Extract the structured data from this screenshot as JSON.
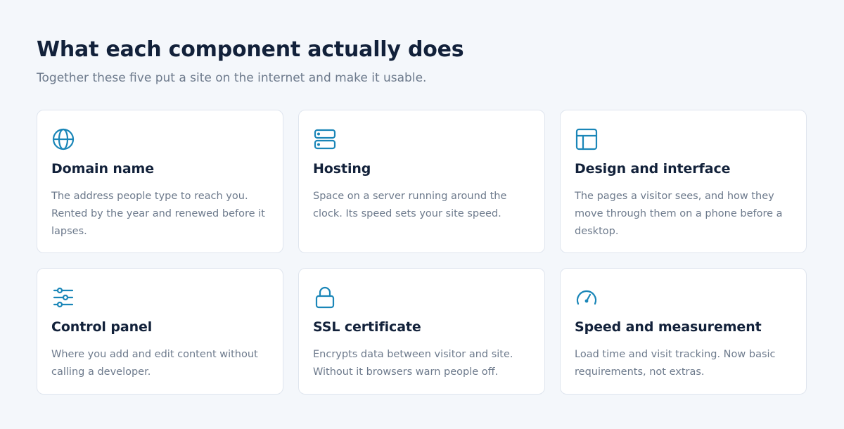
{
  "header": {
    "title": "What each component actually does",
    "subtitle": "Together these five put a site on the internet and make it usable."
  },
  "colors": {
    "accent": "#1a86b8",
    "heading": "#12213a",
    "body_text": "#6d7a8c",
    "background": "#f4f7fb",
    "card": "#ffffff",
    "card_border": "#dfe5ee"
  },
  "cards": [
    {
      "icon": "globe-icon",
      "name": "Domain name",
      "description": "The address people type to reach you. Rented by the year and renewed before it lapses."
    },
    {
      "icon": "server-icon",
      "name": "Hosting",
      "description": "Space on a server running around the clock. Its speed sets your site speed."
    },
    {
      "icon": "layout-icon",
      "name": "Design and interface",
      "description": "The pages a visitor sees, and how they move through them on a phone before a desktop."
    },
    {
      "icon": "sliders-icon",
      "name": "Control panel",
      "description": "Where you add and edit content without calling a developer."
    },
    {
      "icon": "lock-icon",
      "name": "SSL certificate",
      "description": "Encrypts data between visitor and site. Without it browsers warn people off."
    },
    {
      "icon": "gauge-icon",
      "name": "Speed and measurement",
      "description": "Load time and visit tracking. Now basic requirements, not extras."
    }
  ]
}
